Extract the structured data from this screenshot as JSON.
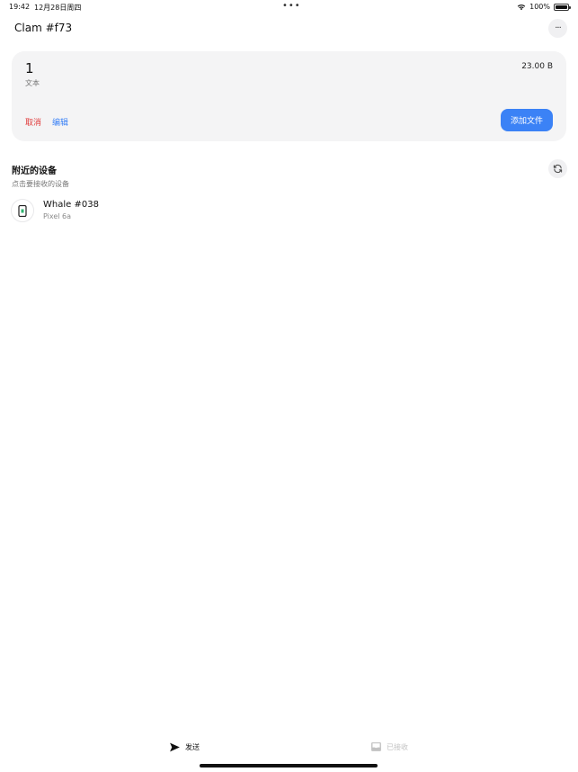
{
  "status_bar": {
    "time": "19:42",
    "date": "12月28日周四",
    "battery": "100%"
  },
  "header": {
    "title": "Clam #f73",
    "more_icon": "ellipsis-icon"
  },
  "selection": {
    "count": "1",
    "type": "文本",
    "size": "23.00 B",
    "cancel_label": "取消",
    "edit_label": "编辑",
    "add_file_label": "添加文件"
  },
  "nearby": {
    "title": "附近的设备",
    "subtitle": "点击要接收的设备",
    "refresh_icon": "refresh-icon",
    "devices": [
      {
        "name": "Whale #038",
        "model": "Pixel 6a",
        "icon": "smartphone-icon"
      }
    ]
  },
  "tabs": {
    "send_label": "发送",
    "received_label": "已接收"
  },
  "colors": {
    "accent": "#3b82f6",
    "danger": "#e03a3a",
    "card_bg": "#f4f4f5",
    "device_icon_accent": "#2db36f"
  }
}
